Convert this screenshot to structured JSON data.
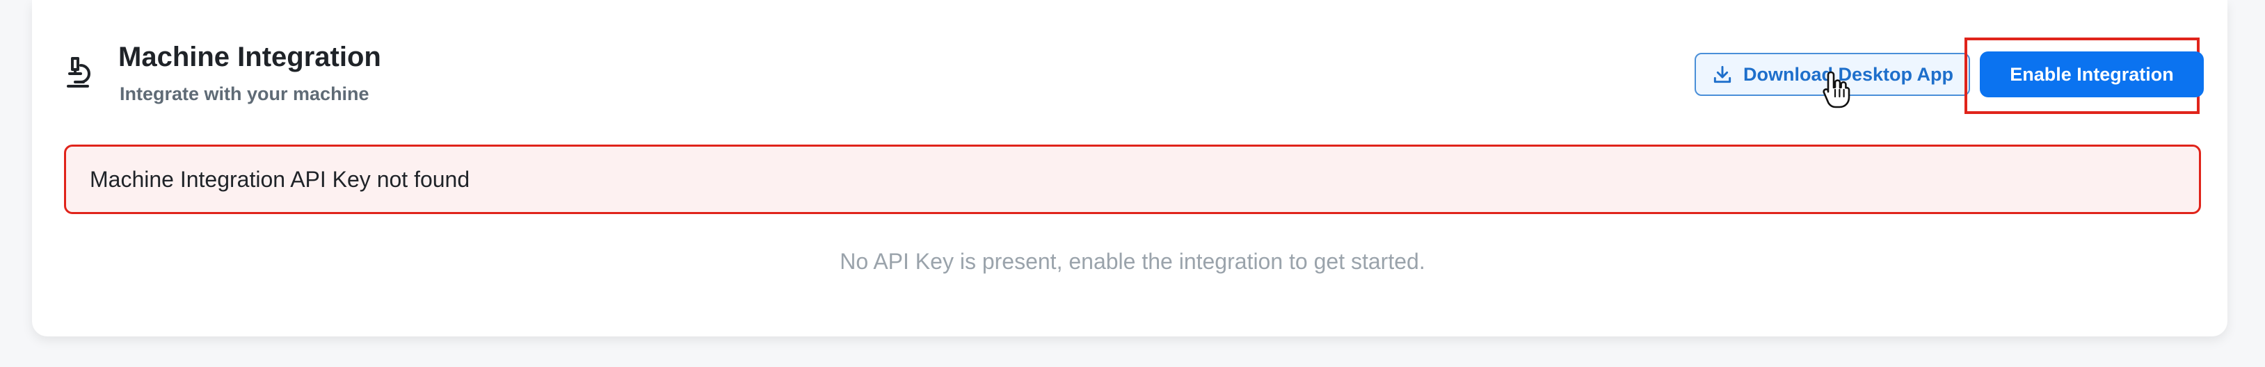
{
  "section": {
    "title": "Machine Integration",
    "subtitle": "Integrate with your machine",
    "icon": "microscope-icon"
  },
  "actions": {
    "download_label": "Download Desktop App",
    "download_icon": "download-icon",
    "enable_label": "Enable Integration"
  },
  "alert": {
    "message": "Machine Integration API Key not found"
  },
  "empty_state": {
    "message": "No API Key is present, enable the integration to get started."
  },
  "colors": {
    "accent": "#0b73f0",
    "error": "#e0241b",
    "alert_bg": "#fdf1f1"
  }
}
